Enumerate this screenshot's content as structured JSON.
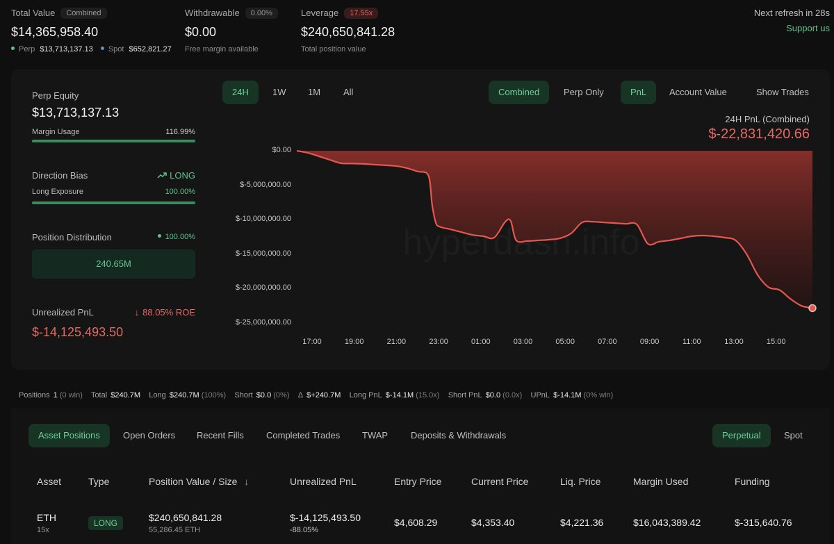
{
  "summary": {
    "total_value": {
      "label": "Total Value",
      "tag": "Combined",
      "value": "$14,365,958.40",
      "perp_label": "Perp",
      "perp_value": "$13,713,137.13",
      "spot_label": "Spot",
      "spot_value": "$652,821.27"
    },
    "withdrawable": {
      "label": "Withdrawable",
      "tag": "0.00%",
      "value": "$0.00",
      "sub": "Free margin available"
    },
    "leverage": {
      "label": "Leverage",
      "tag": "17.55x",
      "value": "$240,650,841.28",
      "sub": "Total position value"
    },
    "refresh": "Next refresh in 28s",
    "support": "Support us"
  },
  "side": {
    "perp_equity_label": "Perp Equity",
    "perp_equity_value": "$13,713,137.13",
    "margin_usage_label": "Margin Usage",
    "margin_usage_value": "116.99%",
    "margin_usage_fill": 1.0,
    "direction_label": "Direction Bias",
    "direction_value": "LONG",
    "long_exposure_label": "Long Exposure",
    "long_exposure_value": "100.00%",
    "long_exposure_fill": 1.0,
    "distribution_label": "Position Distribution",
    "distribution_value": "100.00%",
    "distribution_box": "240.65M",
    "upnl_label": "Unrealized PnL",
    "upnl_roe": "88.05% ROE",
    "upnl_value": "$-14,125,493.50"
  },
  "chart_tabs": {
    "range": [
      "24H",
      "1W",
      "1M",
      "All"
    ],
    "mode": [
      "Combined",
      "Perp Only"
    ],
    "metric": [
      "PnL",
      "Account Value"
    ],
    "show_trades": "Show Trades"
  },
  "chart_title": "24H PnL (Combined)",
  "chart_value": "$-22,831,420.66",
  "watermark": "hyperdash.info",
  "chart_data": {
    "type": "area",
    "x": [
      "17:00",
      "17:30",
      "18:00",
      "18:30",
      "19:00",
      "19:30",
      "20:00",
      "20:30",
      "21:00",
      "21:30",
      "22:00",
      "22:30",
      "23:00",
      "23:10",
      "23:20",
      "23:30",
      "00:00",
      "00:30",
      "01:00",
      "01:30",
      "02:00",
      "02:30",
      "02:45",
      "03:00",
      "03:30",
      "04:00",
      "04:30",
      "05:00",
      "05:30",
      "06:00",
      "06:30",
      "07:00",
      "07:30",
      "08:00",
      "08:30",
      "09:00",
      "09:30",
      "10:00",
      "10:30",
      "11:00",
      "11:30",
      "12:00",
      "12:30",
      "13:00",
      "13:30",
      "14:00",
      "14:30",
      "15:00",
      "15:30",
      "16:00",
      "16:30"
    ],
    "values": [
      0,
      -300000,
      -800000,
      -1300000,
      -1800000,
      -1850000,
      -1900000,
      -2000000,
      -2100000,
      -2200000,
      -2500000,
      -3000000,
      -3600000,
      -7800000,
      -10400000,
      -11000000,
      -11400000,
      -11800000,
      -12200000,
      -12400000,
      -12600000,
      -10300000,
      -10200000,
      -13000000,
      -13100000,
      -13000000,
      -12900000,
      -12700000,
      -12000000,
      -10400000,
      -10300000,
      -10400000,
      -10500000,
      -10600000,
      -10700000,
      -13500000,
      -13200000,
      -13000000,
      -12700000,
      -12400000,
      -12300000,
      -12400000,
      -12600000,
      -13000000,
      -15000000,
      -18000000,
      -19800000,
      -20200000,
      -21500000,
      -22500000,
      -22831420.66
    ],
    "y_ticks": [
      "$0.00",
      "$-5,000,000.00",
      "$-10,000,000.00",
      "$-15,000,000.00",
      "$-20,000,000.00",
      "$-25,000,000.00"
    ],
    "x_ticks": [
      "17:00",
      "19:00",
      "21:00",
      "23:00",
      "01:00",
      "03:00",
      "05:00",
      "07:00",
      "09:00",
      "11:00",
      "13:00",
      "15:00"
    ],
    "ylim": [
      -25000000,
      0
    ],
    "color": "#e5574f"
  },
  "stats": {
    "positions_label": "Positions",
    "positions_value": "1",
    "positions_note": "(0 win)",
    "total_label": "Total",
    "total_value": "$240.7M",
    "long_label": "Long",
    "long_value": "$240.7M",
    "long_note": "(100%)",
    "short_label": "Short",
    "short_value": "$0.0",
    "short_note": "(0%)",
    "delta_label": "Δ",
    "delta_value": "$+240.7M",
    "longpnl_label": "Long PnL",
    "longpnl_value": "$-14.1M",
    "longpnl_note": "(15.0x)",
    "shortpnl_label": "Short PnL",
    "shortpnl_value": "$0.0",
    "shortpnl_note": "(0.0x)",
    "upnl_label": "UPnL",
    "upnl_value": "$-14.1M",
    "upnl_note": "(0% win)"
  },
  "table_tabs": [
    "Asset Positions",
    "Open Orders",
    "Recent Fills",
    "Completed Trades",
    "TWAP",
    "Deposits & Withdrawals"
  ],
  "market_tabs": [
    "Perpetual",
    "Spot"
  ],
  "columns": [
    "Asset",
    "Type",
    "Position Value / Size",
    "Unrealized PnL",
    "Entry Price",
    "Current Price",
    "Liq. Price",
    "Margin Used",
    "Funding"
  ],
  "sort_icon": "arrow-down-icon",
  "row": {
    "asset": "ETH",
    "leverage": "15x",
    "type": "LONG",
    "position_value": "$240,650,841.28",
    "size": "55,286.45 ETH",
    "upnl": "$-14,125,493.50",
    "upnl_pct": "-88.05%",
    "entry": "$4,608.29",
    "current": "$4,353.40",
    "liq": "$4,221.36",
    "margin": "$16,043,389.42",
    "funding": "$-315,640.76"
  }
}
